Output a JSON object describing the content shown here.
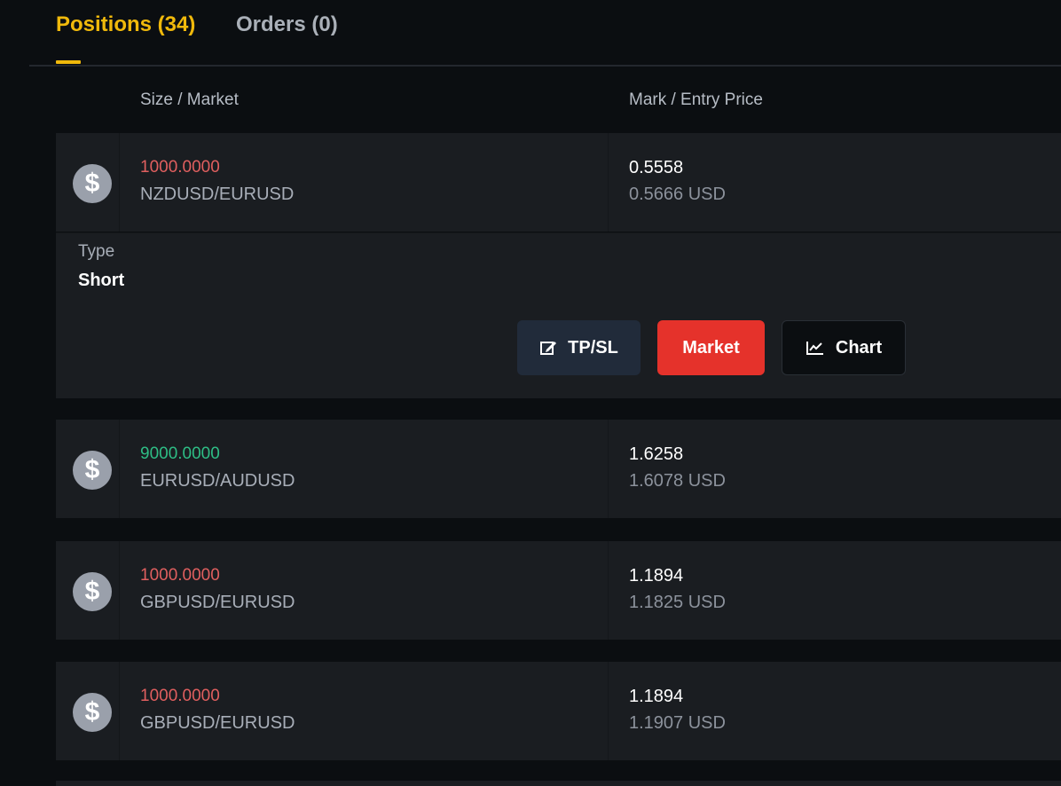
{
  "tabs": {
    "positions_label": "Positions (34)",
    "orders_label": "Orders (0)"
  },
  "columns": {
    "size_market": "Size / Market",
    "mark_entry": "Mark / Entry Price"
  },
  "positions": [
    {
      "size": "1000.0000",
      "direction": "negative",
      "market": "NZDUSD/EURUSD",
      "mark": "0.5558",
      "entry": "0.5666 USD",
      "icon": "dollar-icon"
    },
    {
      "size": "9000.0000",
      "direction": "positive",
      "market": "EURUSD/AUDUSD",
      "mark": "1.6258",
      "entry": "1.6078 USD",
      "icon": "dollar-icon"
    },
    {
      "size": "1000.0000",
      "direction": "negative",
      "market": "GBPUSD/EURUSD",
      "mark": "1.1894",
      "entry": "1.1825 USD",
      "icon": "dollar-icon"
    },
    {
      "size": "1000.0000",
      "direction": "negative",
      "market": "GBPUSD/EURUSD",
      "mark": "1.1894",
      "entry": "1.1907 USD",
      "icon": "dollar-icon"
    }
  ],
  "expanded": {
    "type_label": "Type",
    "type_value": "Short",
    "buttons": {
      "tpsl": "TP/SL",
      "market": "Market",
      "chart": "Chart"
    }
  },
  "colors": {
    "accent": "#f0b90b",
    "negative": "#e05f5f",
    "positive": "#2ebd85",
    "market_button": "#e5322b"
  }
}
